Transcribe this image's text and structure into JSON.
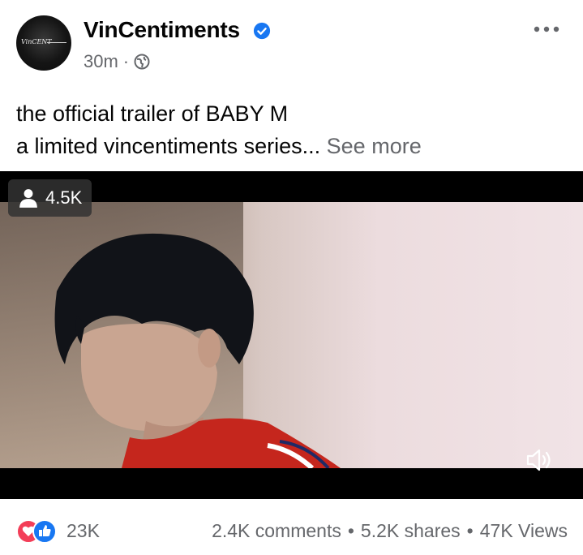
{
  "post": {
    "page_name": "VinCentiments",
    "time": "30m",
    "meta_separator": "·",
    "avatar_signature": "VinCENT",
    "caption_line1": "the official trailer of BABY M",
    "caption_line2": "a limited vincentiments series...",
    "see_more": "See more"
  },
  "video": {
    "viewer_count": "4.5K",
    "muted": true
  },
  "stats": {
    "reaction_count": "23K",
    "comments": "2.4K comments",
    "shares": "5.2K shares",
    "views": "47K Views",
    "separator": "•"
  },
  "colors": {
    "brand_blue": "#1877f2",
    "love_red": "#f33e58",
    "secondary_text": "#65676b"
  },
  "icons": [
    "verified-badge-icon",
    "globe-icon",
    "more-options-icon",
    "viewer-person-icon",
    "volume-icon",
    "love-reaction-icon",
    "like-reaction-icon"
  ]
}
